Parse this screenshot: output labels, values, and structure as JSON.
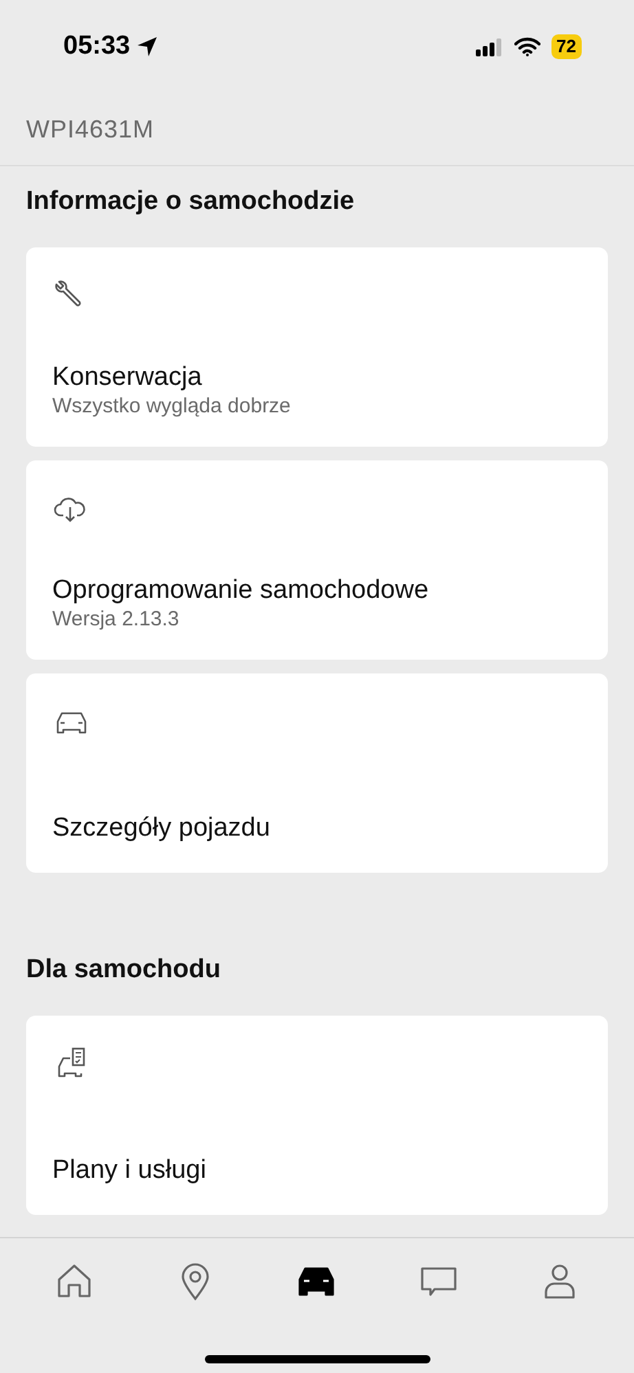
{
  "status_bar": {
    "time": "05:33",
    "battery": "72"
  },
  "plate": "WPI4631M",
  "sections": [
    {
      "title": "Informacje o samochodzie",
      "cards": [
        {
          "kind": "wrench",
          "title": "Konserwacja",
          "subtitle": "Wszystko wygląda dobrze"
        },
        {
          "kind": "cloud",
          "title": "Oprogramowanie samochodowe",
          "subtitle": "Wersja 2.13.3"
        },
        {
          "kind": "car",
          "title": "Szczegóły pojazdu"
        }
      ]
    },
    {
      "title": "Dla samochodu",
      "cards": [
        {
          "kind": "plans",
          "title": "Plany i usługi"
        }
      ]
    }
  ],
  "tab_bar": [
    {
      "kind": "home",
      "selected": false
    },
    {
      "kind": "pin",
      "selected": false
    },
    {
      "kind": "car",
      "selected": true
    },
    {
      "kind": "chat",
      "selected": false
    },
    {
      "kind": "profile",
      "selected": false
    }
  ]
}
